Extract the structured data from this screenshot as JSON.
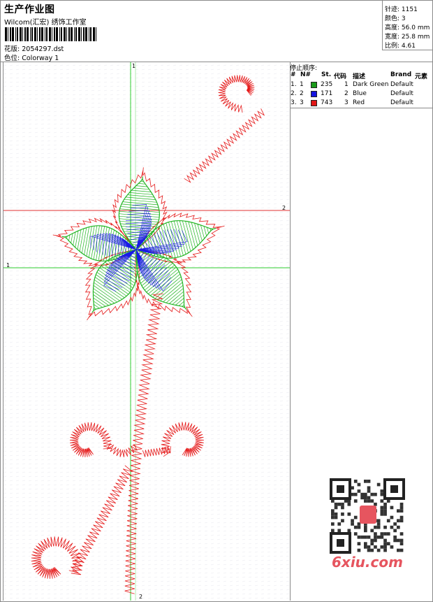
{
  "header": {
    "title": "生产作业图",
    "company": "Wilcom(汇宏) 绣饰工作室",
    "design_label": "花版:",
    "design_value": "2054297.dst",
    "colorway_label": "色位:",
    "colorway_value": "Colorway 1"
  },
  "stats": [
    {
      "label": "针迹:",
      "value": "1151"
    },
    {
      "label": "颜色:",
      "value": "3"
    },
    {
      "label": "高度:",
      "value": "56.0 mm"
    },
    {
      "label": "宽度:",
      "value": "25.8 mm"
    },
    {
      "label": "比例:",
      "value": "4.61"
    }
  ],
  "canvas": {
    "crosshair_labels": {
      "h_green": "1",
      "h_red": "2",
      "v_green_top": "1",
      "v_green_bottom": "2"
    }
  },
  "stop_sequence": {
    "title": "停止顺序:",
    "columns": [
      "#",
      "N#",
      "St.",
      "代码",
      "描述",
      "Brand",
      "元素"
    ],
    "rows": [
      {
        "idx": "1.",
        "n": "1",
        "color": "#1a9a1a",
        "stitches": "235",
        "code": "1",
        "desc": "Dark Green",
        "brand": "Default"
      },
      {
        "idx": "2.",
        "n": "2",
        "color": "#1515e0",
        "stitches": "171",
        "code": "2",
        "desc": "Blue",
        "brand": "Default"
      },
      {
        "idx": "3.",
        "n": "3",
        "color": "#e01515",
        "stitches": "743",
        "code": "3",
        "desc": "Red",
        "brand": "Default"
      }
    ]
  },
  "watermark": {
    "text": "6xiu.com"
  },
  "colors": {
    "green": "#22b522",
    "blue": "#1a1ae6",
    "red": "#e51a1a",
    "guide_green": "#2ecc2e",
    "guide_red": "#e03030"
  }
}
